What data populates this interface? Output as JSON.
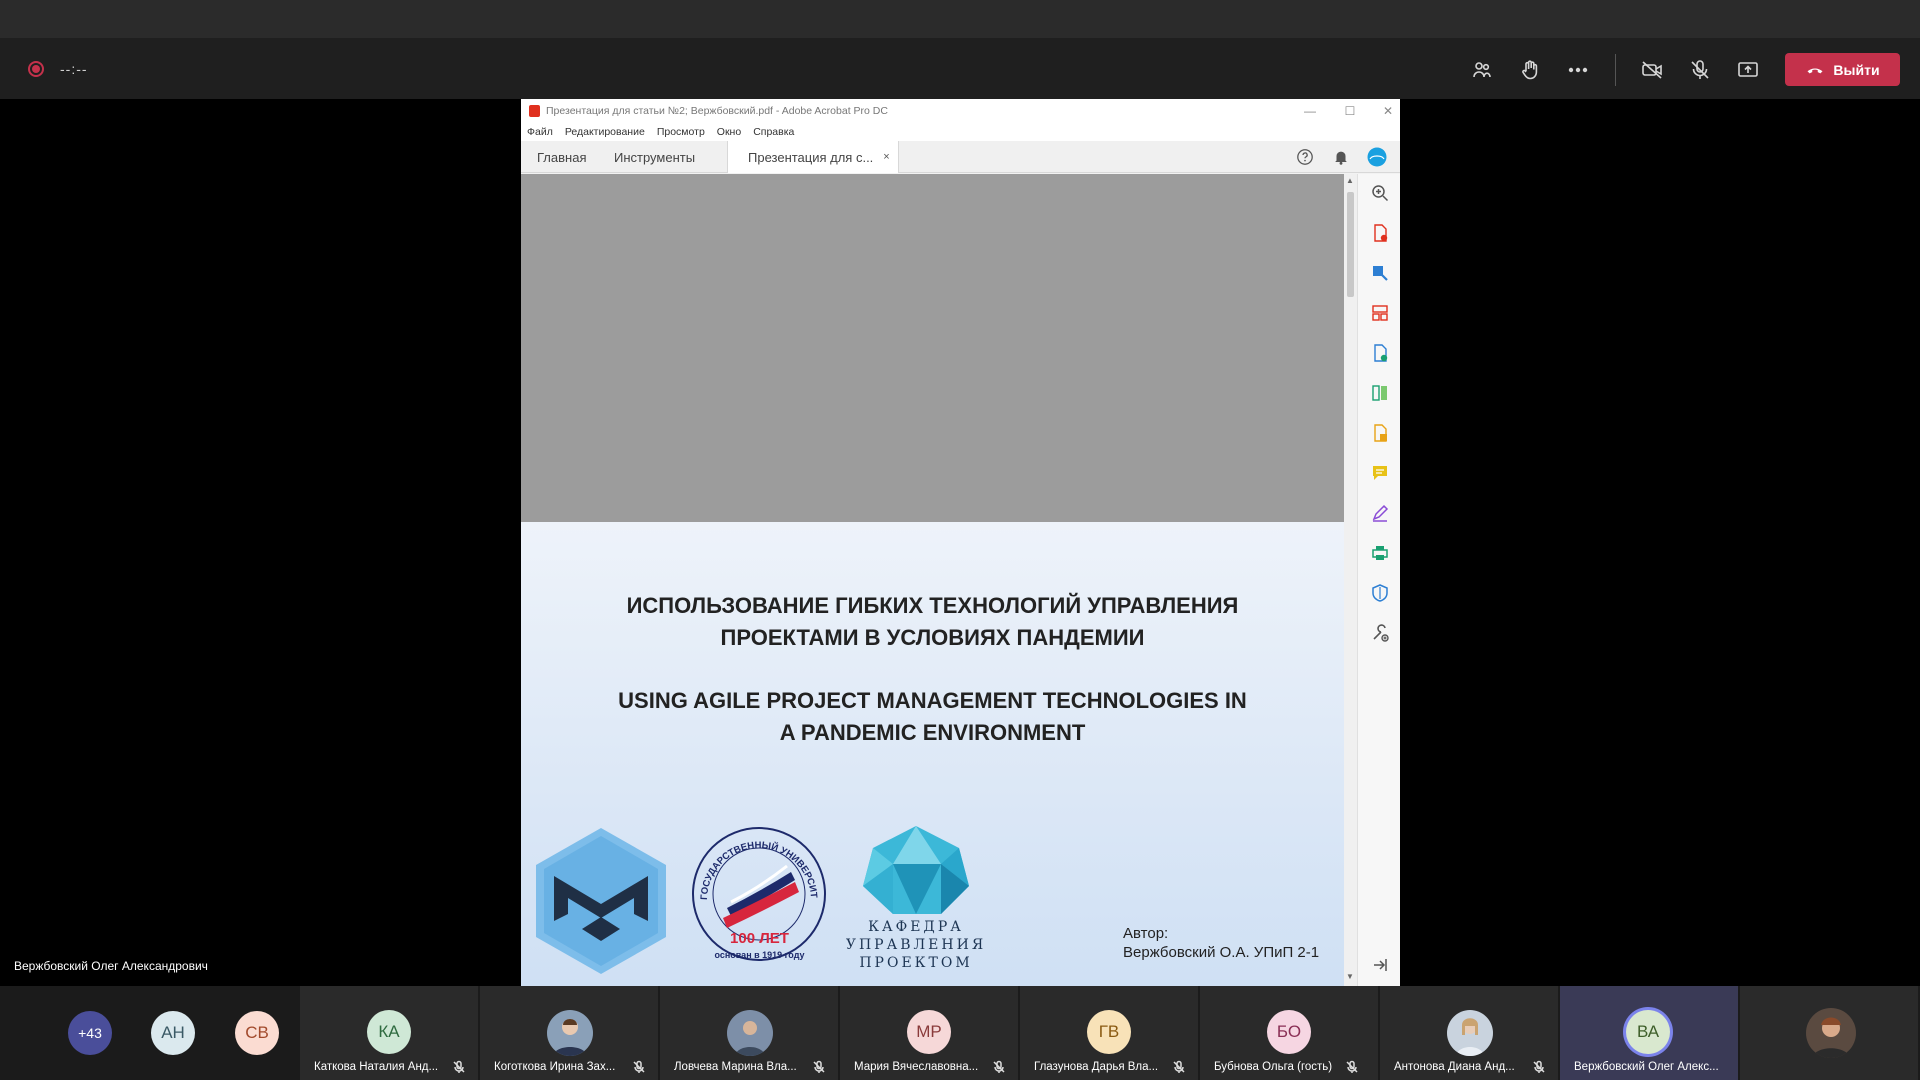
{
  "call": {
    "timer": "--:--",
    "leave_label": "Выйти"
  },
  "colors": {
    "leave": "#c4314b",
    "tile": "#2a2a2a",
    "speaking_tile": "#3a3a56",
    "acrobat_red": "#e0301e"
  },
  "toolbar_icons": [
    "participants-icon",
    "raise-hand-icon",
    "more-icon",
    "camera-off-icon",
    "mic-off-icon",
    "share-screen-icon"
  ],
  "acrobat": {
    "window_title": "Презентация для статьи №2; Вержбовский.pdf - Adobe Acrobat Pro DC",
    "menu": [
      "Файл",
      "Редактирование",
      "Просмотр",
      "Окно",
      "Справка"
    ],
    "tabs": {
      "home": "Главная",
      "tools": "Инструменты",
      "document": "Презентация для с..."
    },
    "close_glyph": "×"
  },
  "slide": {
    "title_ru_line1": "ИСПОЛЬЗОВАНИЕ ГИБКИХ ТЕХНОЛОГИЙ УПРАВЛЕНИЯ",
    "title_ru_line2": "ПРОЕКТАМИ В УСЛОВИЯХ ПАНДЕМИИ",
    "title_en_line1": "USING AGILE PROJECT MANAGEMENT TECHNOLOGIES IN",
    "title_en_line2": "A PANDEMIC ENVIRONMENT",
    "author_label": "Автор:",
    "author_name": "Вержбовский О.А. УПиП 2-1",
    "seal_years": "100 ЛЕТ",
    "seal_since": "основан в 1919 году",
    "seal_ring_text": "ГОСУДАРСТВЕННЫЙ УНИВЕРСИТЕТ УПРАВЛЕНИЯ",
    "dept_line1": "КАФЕДРА",
    "dept_line2": "УПРАВЛЕНИЯ",
    "dept_line3": "ПРОЕКТОМ"
  },
  "presenter": "Вержбовский Олег Александрович",
  "overflow_count": "+43",
  "participants": [
    {
      "initials": "АН",
      "name": "",
      "bg": "#dbe9ee",
      "fg": "#3b5a66"
    },
    {
      "initials": "СВ",
      "name": "",
      "bg": "#fbdcd2",
      "fg": "#a24a2c"
    },
    {
      "initials": "КА",
      "name": "Каткова Наталия Анд...",
      "bg": "#cfe8d6",
      "fg": "#2f6b40"
    },
    {
      "initials": "",
      "name": "Коготкова Ирина Зах...",
      "bg": "#8aa0b8",
      "fg": "#fff"
    },
    {
      "initials": "",
      "name": "Ловчева Марина Вла...",
      "bg": "#7d8fa8",
      "fg": "#fff"
    },
    {
      "initials": "МР",
      "name": "Мария Вячеславовна...",
      "bg": "#f6d8d8",
      "fg": "#8a3b3b"
    },
    {
      "initials": "ГВ",
      "name": "Глазунова Дарья Вла...",
      "bg": "#f8e2b8",
      "fg": "#8a5a12"
    },
    {
      "initials": "БО",
      "name": "Бубнова Ольга (гость)",
      "bg": "#f6d6e2",
      "fg": "#8a2f55"
    },
    {
      "initials": "",
      "name": "Антонова Диана Анд...",
      "bg": "#c9d3de",
      "fg": "#fff"
    },
    {
      "initials": "ВА",
      "name": "Вержбовский Олег Алекс...",
      "bg": "#d9e8cf",
      "fg": "#3e5f2a"
    }
  ]
}
